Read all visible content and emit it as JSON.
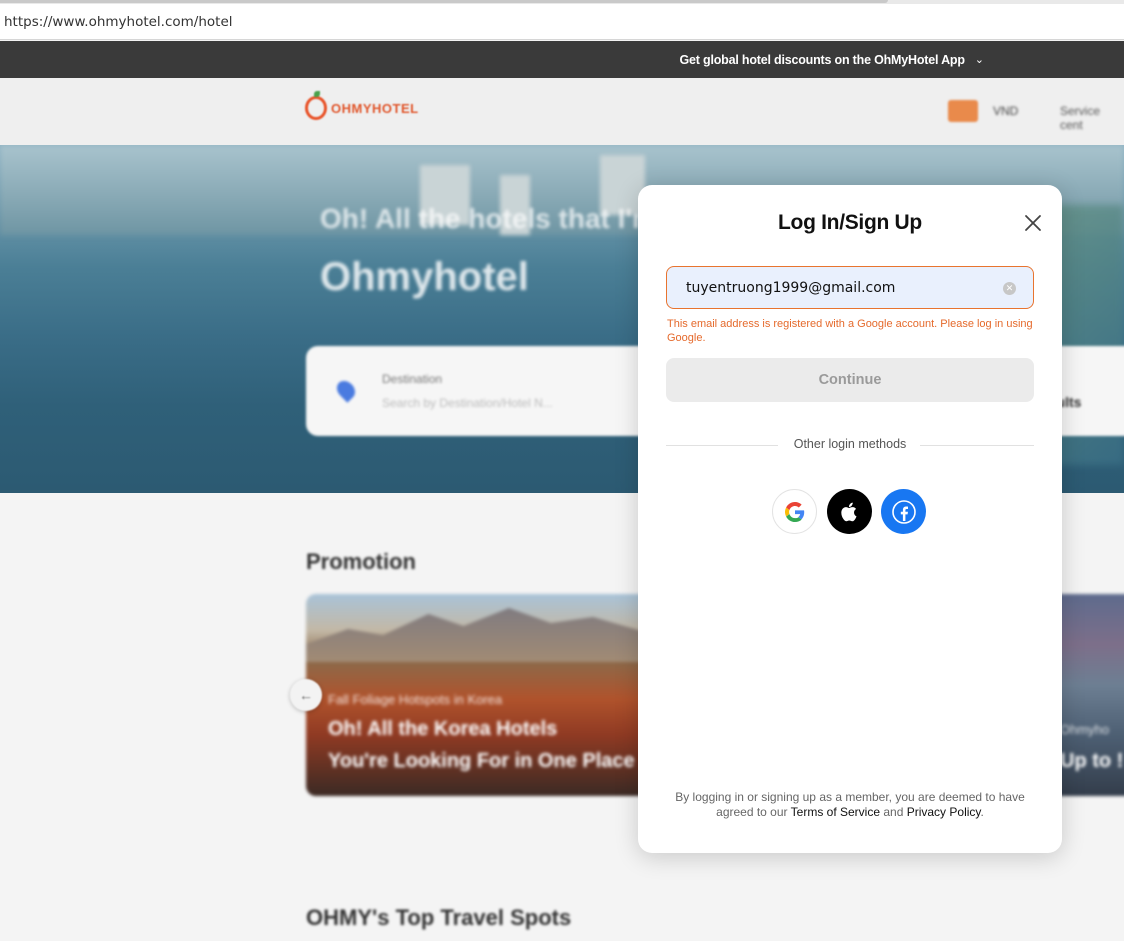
{
  "browser": {
    "url": "https://www.ohmyhotel.com/hotel"
  },
  "page": {
    "promo_bar": {
      "text": "Get global hotel discounts on the OhMyHotel App",
      "chevron_icon": "chevron-down-icon"
    },
    "header": {
      "logo_text": "OHMYHOTEL",
      "currency": "VND",
      "service_center": "Service cent"
    },
    "hero": {
      "line1": "Oh! All the hotels that I'm",
      "line2": "Ohmyhotel",
      "search": {
        "destination_label": "Destination",
        "destination_placeholder": "Search by Destination/Hotel N...",
        "guests_fragment": "dults"
      }
    },
    "promotion": {
      "title": "Promotion",
      "card1": {
        "subtitle": "Fall Foliage Hotspots in Korea",
        "title_line1": "Oh! All the Korea Hotels",
        "title_line2": "You're Looking For in One Place"
      },
      "card2": {
        "subtitle": "Ohmyho",
        "title": "Up to !"
      }
    },
    "top_spots_title": "OHMY's Top Travel Spots"
  },
  "modal": {
    "title": "Log In/Sign Up",
    "email_value": "tuyentruong1999@gmail.com",
    "error_message": "This email address is registered with a Google account. Please log in using Google.",
    "continue_label": "Continue",
    "other_methods_label": "Other login methods",
    "social": [
      "google-icon",
      "apple-icon",
      "facebook-icon"
    ],
    "terms_prefix": "By logging in or signing up as a member, you are deemed to have agreed to our ",
    "terms_link": "Terms of Service",
    "terms_and": " and ",
    "privacy_link": "Privacy Policy",
    "terms_suffix": "."
  },
  "colors": {
    "error": "#e56a2c",
    "field_border": "#e8742f",
    "field_bg": "#e9f0fd",
    "facebook": "#1877f2",
    "apple": "#000000",
    "brand": "#e0572d"
  }
}
